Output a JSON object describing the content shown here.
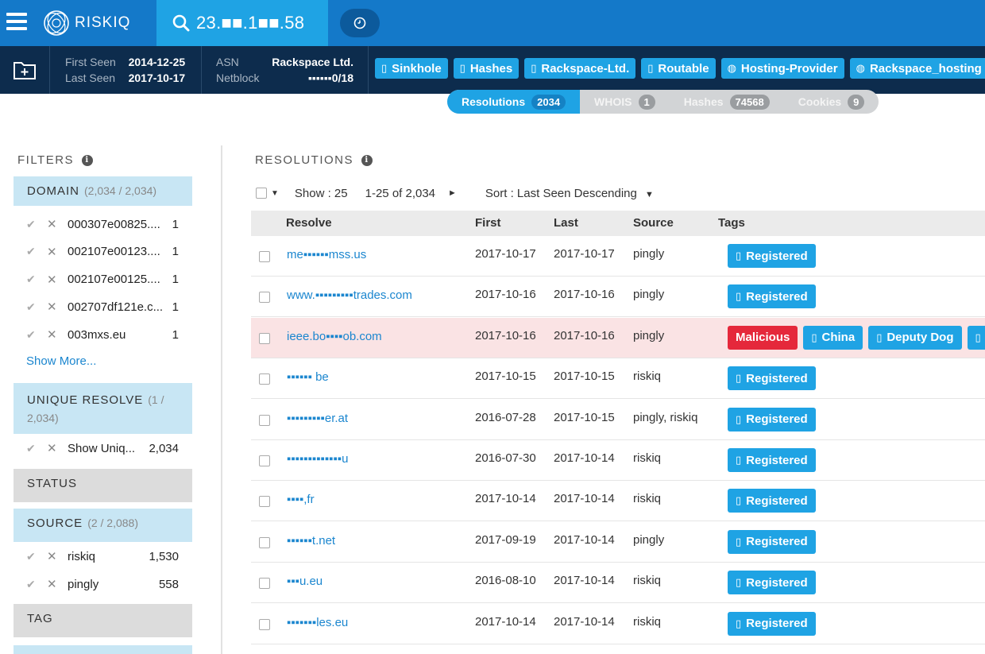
{
  "app": {
    "brand": "RISKIQ",
    "search_value": "23.■■.1■■.58"
  },
  "infobar": {
    "first_seen_label": "First Seen",
    "first_seen_value": "2014-12-25",
    "last_seen_label": "Last Seen",
    "last_seen_value": "2017-10-17",
    "asn_label": "ASN",
    "asn_value": "Rackspace Ltd.",
    "netblock_label": "Netblock",
    "netblock_value": "▪▪▪▪▪▪0/18",
    "tags": [
      {
        "label": "Sinkhole",
        "icon": "building-icon"
      },
      {
        "label": "Hashes",
        "icon": "building-icon"
      },
      {
        "label": "Rackspace-Ltd.",
        "icon": "building-icon"
      },
      {
        "label": "Routable",
        "icon": "building-icon"
      },
      {
        "label": "Hosting-Provider",
        "icon": "globe-icon"
      },
      {
        "label": "Rackspace_hosting",
        "icon": "globe-icon"
      }
    ]
  },
  "tabs": [
    {
      "label": "Resolutions",
      "count": "2034",
      "active": true
    },
    {
      "label": "WHOIS",
      "count": "1",
      "active": false
    },
    {
      "label": "Hashes",
      "count": "74568",
      "active": false
    },
    {
      "label": "Cookies",
      "count": "9",
      "active": false
    }
  ],
  "filters": {
    "title": "FILTERS",
    "domain": {
      "label": "DOMAIN",
      "count": "(2,034 / 2,034)",
      "items": [
        {
          "name": "000307e00825....",
          "count": "1"
        },
        {
          "name": "002107e00123....",
          "count": "1"
        },
        {
          "name": "002107e00125....",
          "count": "1"
        },
        {
          "name": "002707df121e.c...",
          "count": "1"
        },
        {
          "name": "003mxs.eu",
          "count": "1"
        }
      ],
      "show_more": "Show More..."
    },
    "unique": {
      "label": "UNIQUE RESOLVE",
      "count": "(1 /",
      "count2": "2,034)",
      "items": [
        {
          "name": "Show Uniq...",
          "count": "2,034"
        }
      ]
    },
    "status": {
      "label": "STATUS"
    },
    "source": {
      "label": "SOURCE",
      "count": "(2 / 2,088)",
      "items": [
        {
          "name": "riskiq",
          "count": "1,530"
        },
        {
          "name": "pingly",
          "count": "558"
        }
      ]
    },
    "tag": {
      "label": "TAG"
    }
  },
  "main": {
    "title": "RESOLUTIONS",
    "show": "Show : 25",
    "range": "1-25 of 2,034",
    "sort": "Sort : Last Seen Descending",
    "columns": {
      "resolve": "Resolve",
      "first": "First",
      "last": "Last",
      "source": "Source",
      "tags": "Tags"
    },
    "rows": [
      {
        "resolve": "me▪▪▪▪▪▪mss.us",
        "first": "2017-10-17",
        "last": "2017-10-17",
        "source": "pingly",
        "malicious": false,
        "tags": [
          {
            "label": "Registered",
            "color": "blue"
          }
        ]
      },
      {
        "resolve": "www.▪▪▪▪▪▪▪▪▪trades.com",
        "first": "2017-10-16",
        "last": "2017-10-16",
        "source": "pingly",
        "malicious": false,
        "tags": [
          {
            "label": "Registered",
            "color": "blue"
          }
        ]
      },
      {
        "resolve": "ieee.bo▪▪▪▪ob.com",
        "first": "2017-10-16",
        "last": "2017-10-16",
        "source": "pingly",
        "malicious": true,
        "tags": [
          {
            "label": "Malicious",
            "color": "red"
          },
          {
            "label": "China",
            "color": "blue"
          },
          {
            "label": "Deputy Dog",
            "color": "blue"
          },
          {
            "label": "▯",
            "color": "blue"
          }
        ]
      },
      {
        "resolve": "▪▪▪▪▪▪ be",
        "first": "2017-10-15",
        "last": "2017-10-15",
        "source": "riskiq",
        "malicious": false,
        "tags": [
          {
            "label": "Registered",
            "color": "blue"
          }
        ]
      },
      {
        "resolve": "▪▪▪▪▪▪▪▪▪er.at",
        "first": "2016-07-28",
        "last": "2017-10-15",
        "source": "pingly, riskiq",
        "malicious": false,
        "tags": [
          {
            "label": "Registered",
            "color": "blue"
          }
        ]
      },
      {
        "resolve": "▪▪▪▪▪▪▪▪▪▪▪▪▪u",
        "first": "2016-07-30",
        "last": "2017-10-14",
        "source": "riskiq",
        "malicious": false,
        "tags": [
          {
            "label": "Registered",
            "color": "blue"
          }
        ]
      },
      {
        "resolve": "▪▪▪▪,fr",
        "first": "2017-10-14",
        "last": "2017-10-14",
        "source": "riskiq",
        "malicious": false,
        "tags": [
          {
            "label": "Registered",
            "color": "blue"
          }
        ]
      },
      {
        "resolve": "▪▪▪▪▪▪t.net",
        "first": "2017-09-19",
        "last": "2017-10-14",
        "source": "pingly",
        "malicious": false,
        "tags": [
          {
            "label": "Registered",
            "color": "blue"
          }
        ]
      },
      {
        "resolve": "▪▪▪u.eu",
        "first": "2016-08-10",
        "last": "2017-10-14",
        "source": "riskiq",
        "malicious": false,
        "tags": [
          {
            "label": "Registered",
            "color": "blue"
          }
        ]
      },
      {
        "resolve": "▪▪▪▪▪▪▪les.eu",
        "first": "2017-10-14",
        "last": "2017-10-14",
        "source": "riskiq",
        "malicious": false,
        "tags": [
          {
            "label": "Registered",
            "color": "blue"
          }
        ]
      }
    ]
  }
}
